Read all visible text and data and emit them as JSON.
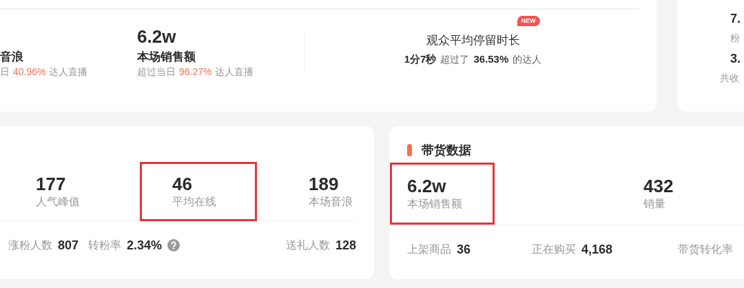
{
  "overview": {
    "items": [
      {
        "label": "音浪",
        "compare_prefix": "日",
        "percent": "40.96%",
        "compare_suffix": "达人直播"
      },
      {
        "value": "6.2w",
        "label": "本场销售额",
        "compare_prefix": "超过当日",
        "percent": "96.27%",
        "compare_suffix": "达人直播"
      }
    ],
    "dwell": {
      "title": "观众平均停留时长",
      "badge": "NEW",
      "duration": "1分7秒",
      "text_before": "超过了",
      "percent": "36.53%",
      "text_after": "的达人"
    }
  },
  "side_card": {
    "items": [
      {
        "value": "7.",
        "label": "粉"
      },
      {
        "value": "3.",
        "label": "共收"
      }
    ]
  },
  "traffic": {
    "metrics": [
      {
        "value": "177",
        "label": "人气峰值",
        "highlighted": false
      },
      {
        "value": "46",
        "label": "平均在线",
        "highlighted": true
      },
      {
        "value": "189",
        "label": "本场音浪",
        "highlighted": false
      }
    ],
    "stats": [
      {
        "label": "涨粉人数",
        "value": "807",
        "help": false
      },
      {
        "label": "转粉率",
        "value": "2.34%",
        "help": true
      },
      {
        "label": "送礼人数",
        "value": "128",
        "help": false
      }
    ]
  },
  "sales": {
    "title": "带货数据",
    "metrics": [
      {
        "value": "6.2w",
        "label": "本场销售额",
        "highlighted": true
      },
      {
        "value": "432",
        "label": "销量",
        "highlighted": false
      }
    ],
    "stats": [
      {
        "label": "上架商品",
        "value": "36"
      },
      {
        "label": "正在购买",
        "value": "4,168"
      },
      {
        "label": "带货转化率"
      }
    ]
  }
}
